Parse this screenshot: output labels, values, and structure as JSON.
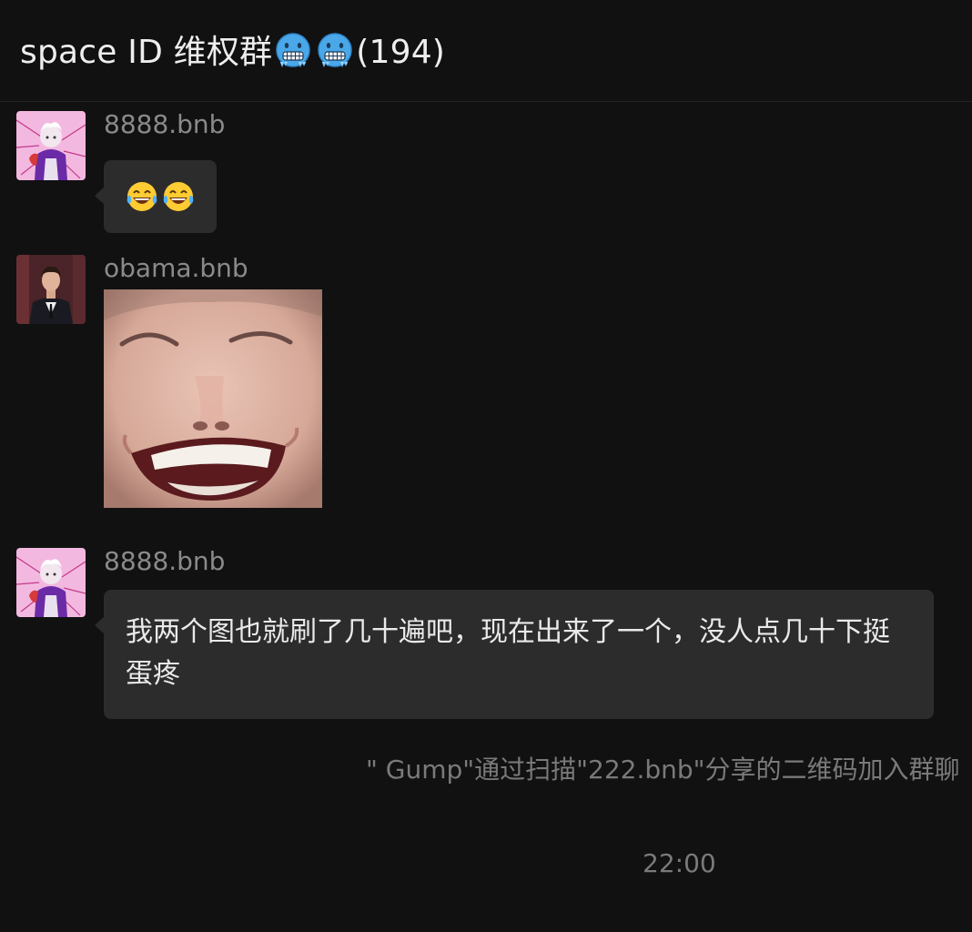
{
  "header": {
    "title_text": "space ID 维权群",
    "title_emojis": [
      "freezing-face-icon",
      "freezing-face-icon"
    ],
    "member_count": "(194)"
  },
  "messages": [
    {
      "sender": "8888.bnb",
      "avatar": "anime-character-avatar",
      "type": "emoji",
      "emojis": [
        "tears-of-joy-icon",
        "tears-of-joy-icon"
      ]
    },
    {
      "sender": "obama.bnb",
      "avatar": "man-in-suit-avatar",
      "type": "sticker",
      "sticker": "laughing-child-sticker"
    },
    {
      "sender": "8888.bnb",
      "avatar": "anime-character-avatar",
      "type": "text",
      "text": "我两个图也就刷了几十遍吧，现在出来了一个，没人点几十下挺蛋疼"
    }
  ],
  "system_message": "\" Gump\"通过扫描\"222.bnb\"分享的二维码加入群聊",
  "timestamp": "22:00",
  "colors": {
    "background": "#111111",
    "bubble": "#2c2c2c",
    "muted_text": "#8a8a8a",
    "primary_text": "#eaeaea"
  }
}
